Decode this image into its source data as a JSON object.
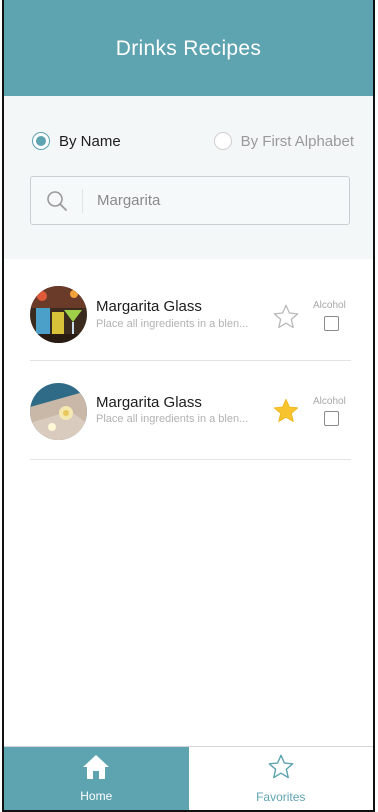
{
  "header": {
    "title": "Drinks Recipes"
  },
  "search": {
    "options": [
      {
        "label": "By Name",
        "selected": true
      },
      {
        "label": "By First Alphabet",
        "selected": false
      }
    ],
    "value": "Margarita",
    "icon": "search-icon"
  },
  "drinks": [
    {
      "title": "Margarita Glass",
      "description": "Place all ingredients in a blen...",
      "favorite": false,
      "alcohol_label": "Alcohol",
      "alcohol_checked": false
    },
    {
      "title": "Margarita Glass",
      "description": "Place all ingredients in a blen...",
      "favorite": true,
      "alcohol_label": "Alcohol",
      "alcohol_checked": false
    }
  ],
  "tabs": [
    {
      "label": "Home",
      "icon": "home-icon",
      "active": true
    },
    {
      "label": "Favorites",
      "icon": "star-icon",
      "active": false
    }
  ],
  "colors": {
    "accent": "#5ea3b0",
    "star": "#f7c32e"
  }
}
